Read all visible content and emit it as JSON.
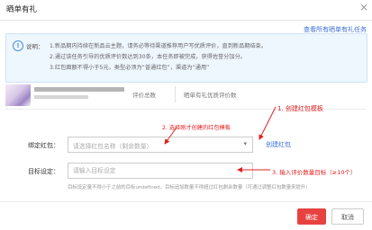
{
  "dialog": {
    "title": "晒单有礼",
    "close_icon": "close-icon",
    "view_all_link": "查看所有晒单有礼任务"
  },
  "notice": {
    "icon": "info-icon",
    "label": "说明：",
    "lines": [
      "1.新品期内持续在新品云主题，请务必等待渠道推荐用户写优质评价，直到新品期结束。",
      "2.通过该任务引导的优质评价数达到30条，本任务即被完成，获得佐誉分加分。",
      "3.红包面额不得小于5元，类型必须为“普通红包”，渠道为“通用”"
    ]
  },
  "product": {
    "tabs": [
      "评价总数",
      "晒单有礼优质评价数"
    ]
  },
  "annotations": {
    "create": "1. 创建红包模板",
    "middle": "2. 选择刚才创建的红包模板",
    "target": "3. 输入评价数量目标（≥10个）"
  },
  "form": {
    "redpacket_label": "绑定红包：",
    "redpacket_placeholder": "请选择红包名称（剩余数量）",
    "create_link": "创建红包",
    "target_label": "目标设定：",
    "target_placeholder": "请输入目标设定",
    "hint": "目标设定量不得小于之前的目标undefined，目标追加数量不得超过红包剩余数量（可通过调整红包数量来提升）"
  },
  "buttons": {
    "ok": "确定",
    "cancel": "取消"
  },
  "colors": {
    "accent": "#e64340",
    "link": "#3a6fd8",
    "annotation": "#e02020",
    "notice_bg": "#eef6fe"
  }
}
